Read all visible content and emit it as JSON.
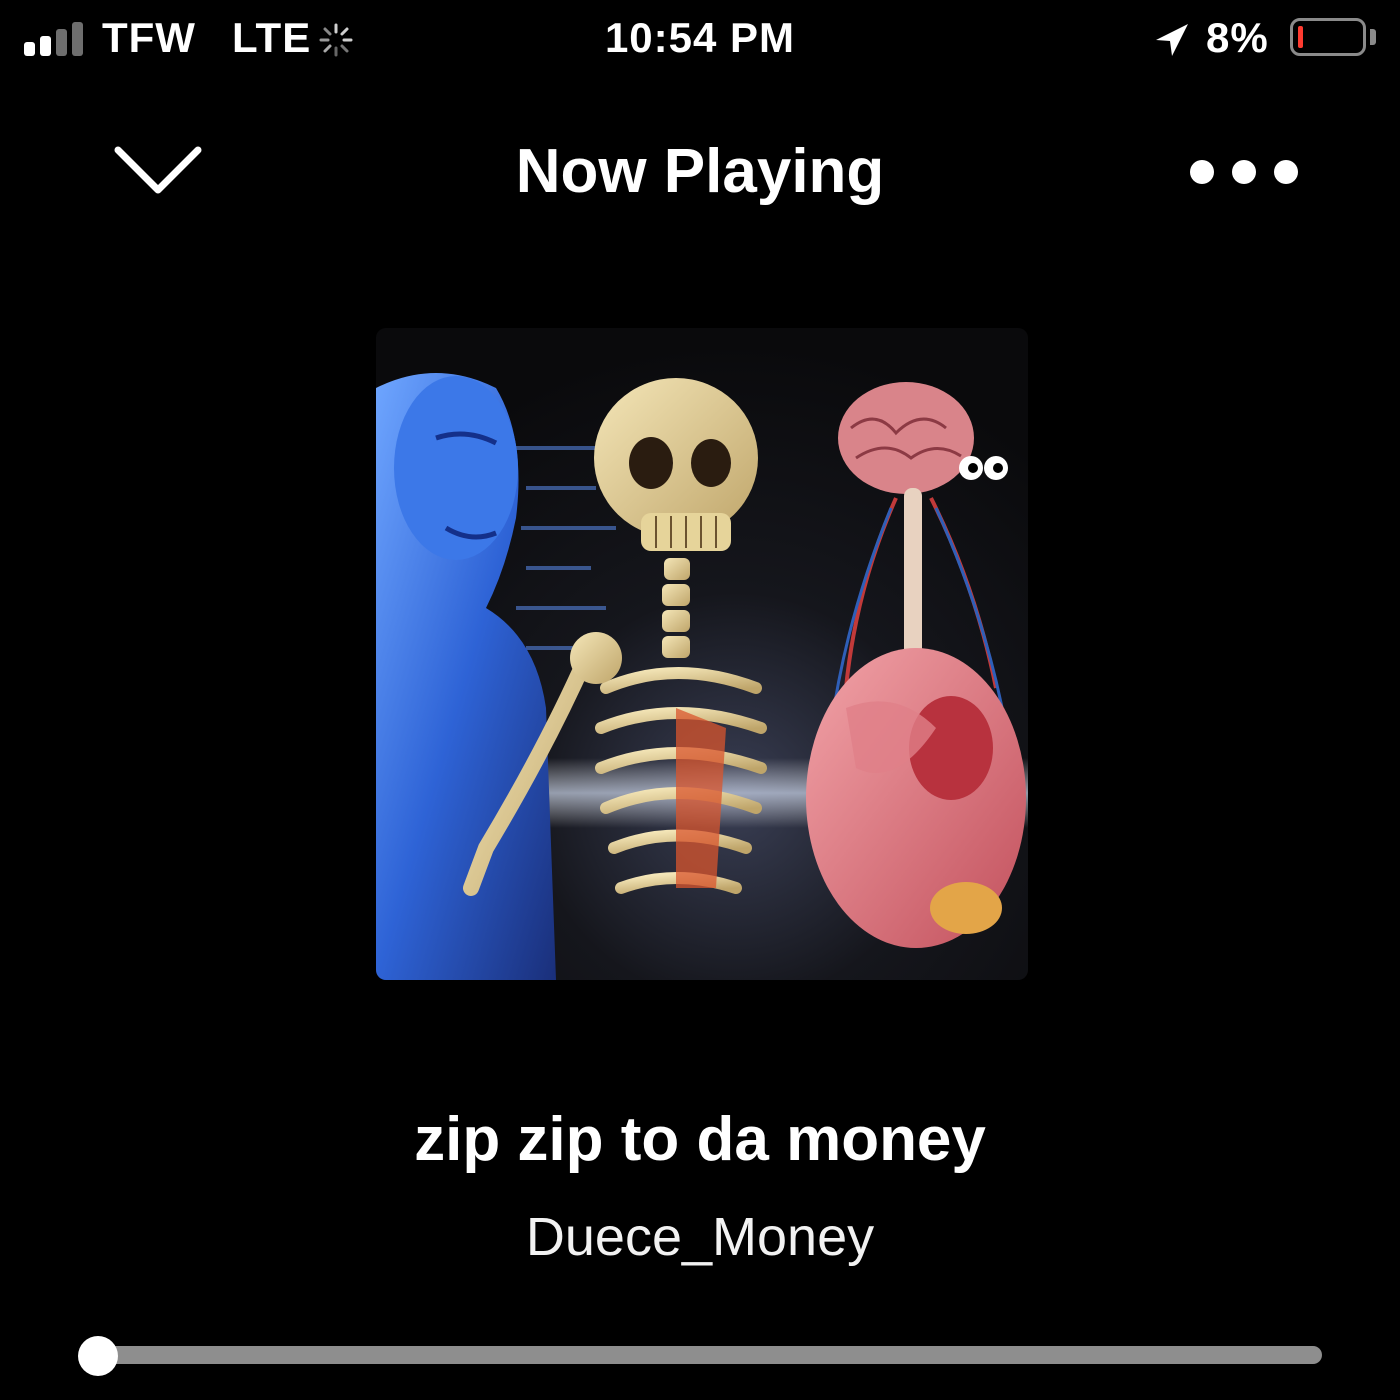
{
  "status_bar": {
    "carrier": "TFW",
    "network": "LTE",
    "time": "10:54 PM",
    "battery_percent": "8%",
    "signal_bars_active": 2,
    "signal_bars_total": 4,
    "battery_level": 0.08,
    "battery_color": "#ff3b30",
    "icons": [
      "signal-icon",
      "activity-spinner-icon",
      "location-arrow-icon",
      "battery-icon"
    ]
  },
  "header": {
    "title": "Now Playing",
    "collapse_icon": "chevron-down-icon",
    "more_icon": "more-dots-icon"
  },
  "album_art": {
    "description_icon": "album-artwork"
  },
  "track": {
    "title": "zip zip to da money",
    "artist": "Duece_Money"
  },
  "playback": {
    "progress": 0.0
  }
}
